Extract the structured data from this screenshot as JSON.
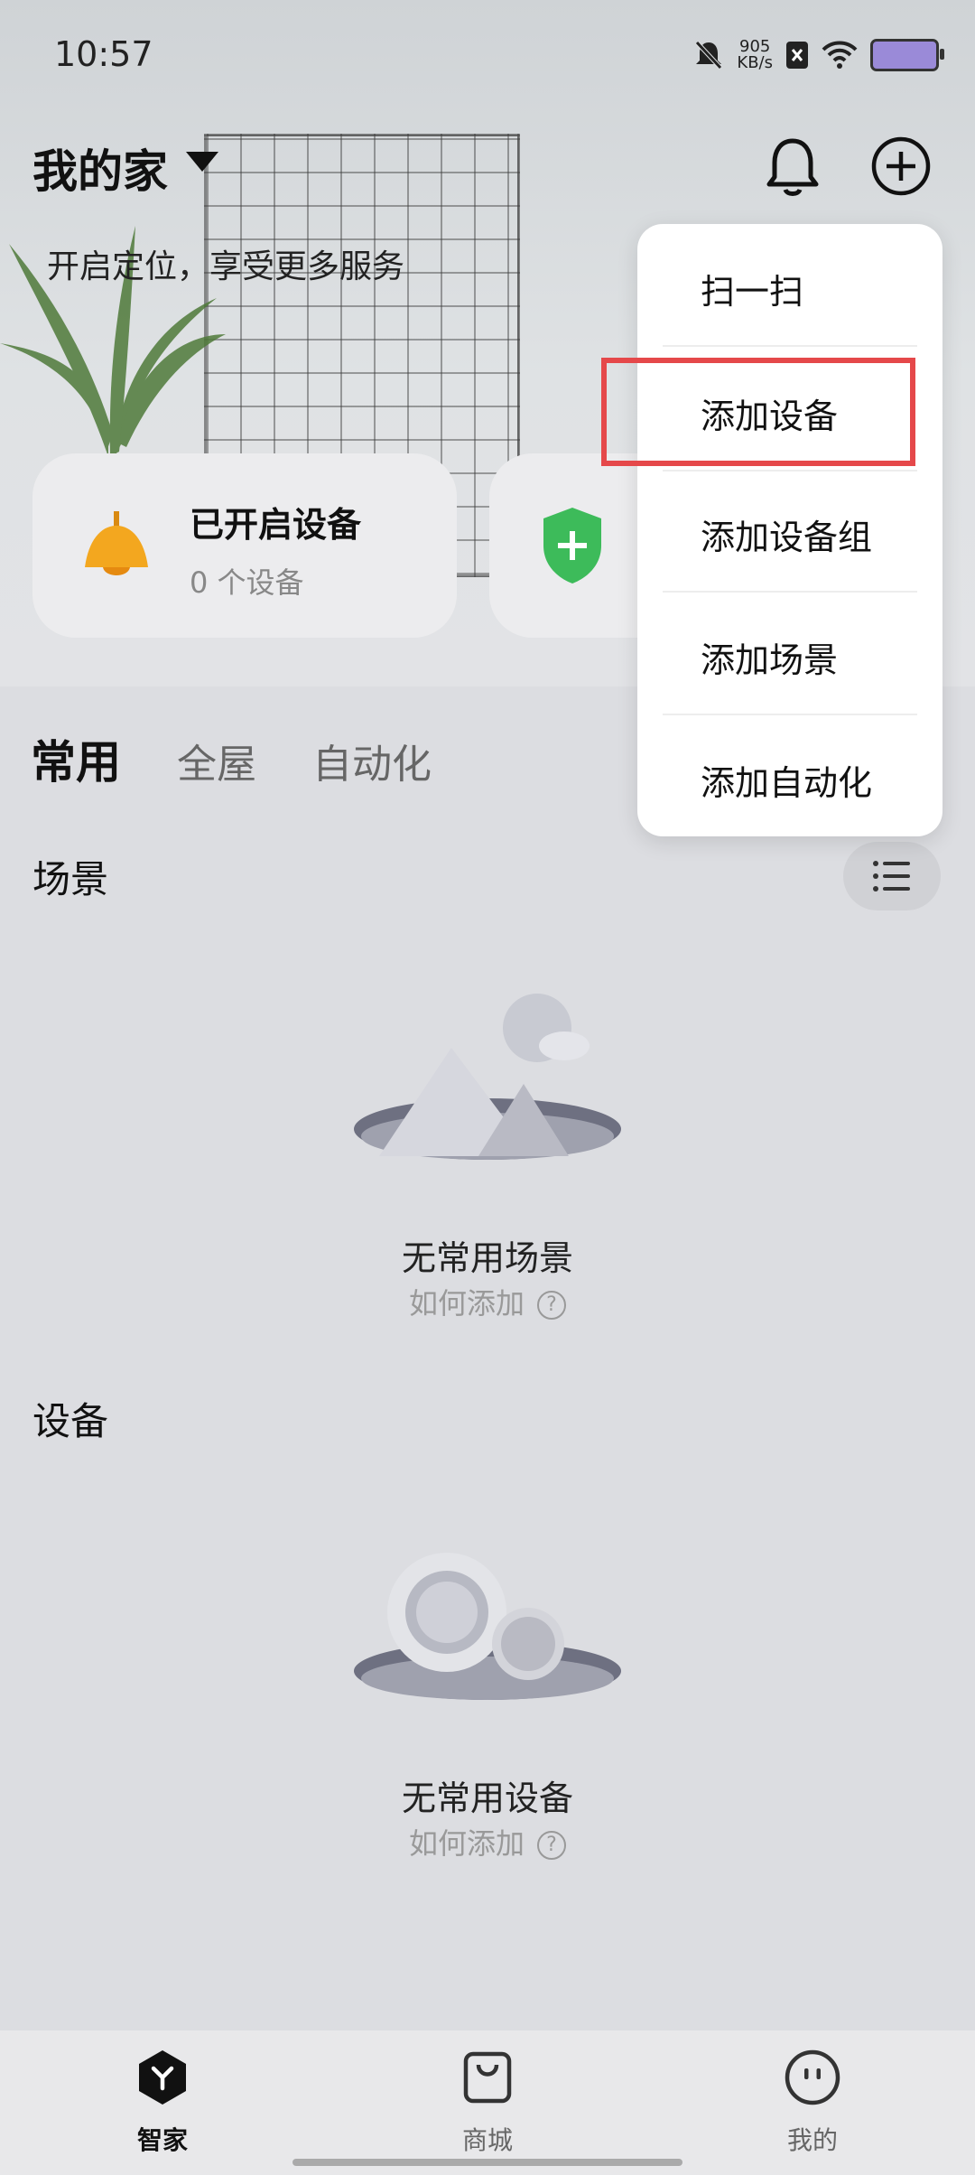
{
  "status_bar": {
    "time": "10:57",
    "net_speed_value": "905",
    "net_speed_unit": "KB/s",
    "icons": [
      "bell-off-icon",
      "netspeed-icon",
      "sim-off-icon",
      "wifi-icon",
      "battery-icon"
    ]
  },
  "header": {
    "home_name": "我的家",
    "location_hint": "开启定位，享受更多服务"
  },
  "cards": [
    {
      "title": "已开启设备",
      "subtitle": "0 个设备",
      "icon": "lamp-icon"
    },
    {
      "icon": "shield-plus-icon"
    }
  ],
  "tabs": [
    {
      "label": "常用",
      "active": true
    },
    {
      "label": "全屋",
      "active": false
    },
    {
      "label": "自动化",
      "active": false
    }
  ],
  "scenes": {
    "title": "场景",
    "empty_title": "无常用场景",
    "empty_link": "如何添加"
  },
  "devices": {
    "title": "设备",
    "empty_title": "无常用设备",
    "empty_link": "如何添加"
  },
  "menu": {
    "items": [
      "扫一扫",
      "添加设备",
      "添加设备组",
      "添加场景",
      "添加自动化"
    ],
    "highlighted": "添加设备",
    "highlight_color": "#e5484a"
  },
  "bottom_nav": [
    {
      "label": "智家",
      "icon": "smarthome-icon",
      "active": true
    },
    {
      "label": "商城",
      "icon": "shopping-bag-icon",
      "active": false
    },
    {
      "label": "我的",
      "icon": "profile-face-icon",
      "active": false
    }
  ]
}
